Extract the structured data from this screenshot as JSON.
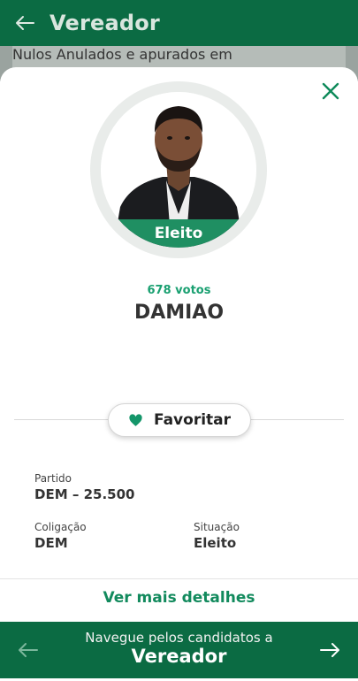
{
  "header": {
    "title": "Vereador"
  },
  "background_content": {
    "nulos_label": "Nulos",
    "anulados_label": "Anulados e apurados em"
  },
  "candidate": {
    "status_badge": "Eleito",
    "votes": "678 votos",
    "name": "DAMIAO",
    "favorite_label": "Favoritar"
  },
  "info": {
    "partido_label": "Partido",
    "partido_value": "DEM – 25.500",
    "coligacao_label": "Coligação",
    "coligacao_value": "DEM",
    "situacao_label": "Situação",
    "situacao_value": "Eleito"
  },
  "details_link": "Ver mais detalhes",
  "footer": {
    "line1": "Navegue pelos candidatos a",
    "line2": "Vereador"
  },
  "colors": {
    "primary": "#0b6b43",
    "accent": "#1aa071",
    "badge": "#1f8f62"
  },
  "icons": [
    "back-arrow-icon",
    "close-icon",
    "heart-icon",
    "arrow-left-icon",
    "arrow-right-icon"
  ]
}
